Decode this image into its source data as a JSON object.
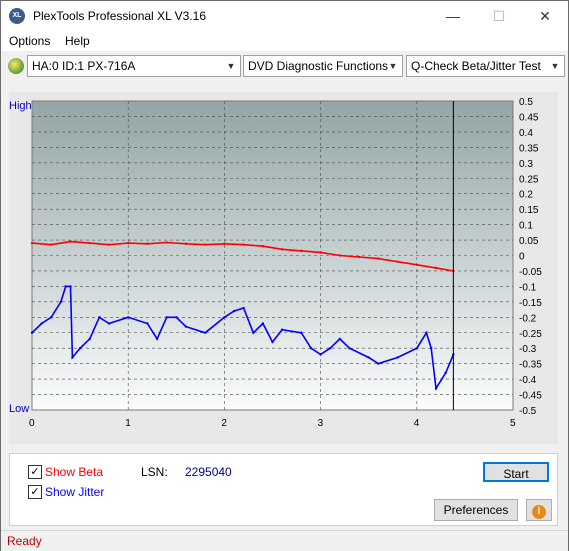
{
  "window": {
    "title": "PlexTools Professional XL V3.16",
    "app_icon_text": "XL",
    "minimize": "—",
    "maximize": "☐",
    "close": "✕"
  },
  "menu": {
    "options": "Options",
    "help": "Help"
  },
  "toolbar": {
    "drive": "HA:0 ID:1  PX-716A",
    "function": "DVD Diagnostic Functions",
    "test": "Q-Check Beta/Jitter Test"
  },
  "chart": {
    "label_high": "High",
    "label_low": "Low",
    "x_ticks": [
      "0",
      "1",
      "2",
      "3",
      "4",
      "5"
    ],
    "y_right_ticks": [
      "0.5",
      "0.45",
      "0.4",
      "0.35",
      "0.3",
      "0.25",
      "0.2",
      "0.15",
      "0.1",
      "0.05",
      "0",
      "-0.05",
      "-0.1",
      "-0.15",
      "-0.2",
      "-0.25",
      "-0.3",
      "-0.35",
      "-0.4",
      "-0.45",
      "-0.5"
    ],
    "colors": {
      "beta": "#ff0000",
      "jitter": "#0000ff",
      "marker": "#000000",
      "grid": "#4a4a4a",
      "text_blue": "#0000c8"
    }
  },
  "chart_data": {
    "type": "line",
    "xlabel": "",
    "ylabel": "",
    "xlim": [
      0,
      5
    ],
    "ylim": [
      -0.5,
      0.5
    ],
    "marker_x": 4.38,
    "series": [
      {
        "name": "Beta",
        "x": [
          0,
          0.2,
          0.4,
          0.6,
          0.8,
          1.0,
          1.2,
          1.4,
          1.6,
          1.8,
          2.0,
          2.2,
          2.4,
          2.6,
          2.8,
          3.0,
          3.2,
          3.4,
          3.6,
          3.8,
          4.0,
          4.2,
          4.38
        ],
        "values": [
          0.04,
          0.035,
          0.045,
          0.04,
          0.035,
          0.04,
          0.038,
          0.042,
          0.038,
          0.035,
          0.038,
          0.035,
          0.03,
          0.02,
          0.015,
          0.01,
          0.0,
          -0.005,
          -0.01,
          -0.02,
          -0.03,
          -0.04,
          -0.05
        ]
      },
      {
        "name": "Jitter",
        "x": [
          0,
          0.1,
          0.2,
          0.3,
          0.35,
          0.4,
          0.42,
          0.5,
          0.6,
          0.7,
          0.8,
          1.0,
          1.2,
          1.3,
          1.4,
          1.5,
          1.6,
          1.8,
          2.0,
          2.1,
          2.2,
          2.3,
          2.4,
          2.5,
          2.6,
          2.8,
          2.9,
          3.0,
          3.1,
          3.2,
          3.3,
          3.5,
          3.6,
          3.8,
          4.0,
          4.1,
          4.15,
          4.2,
          4.3,
          4.38
        ],
        "values": [
          -0.25,
          -0.22,
          -0.2,
          -0.15,
          -0.1,
          -0.1,
          -0.33,
          -0.3,
          -0.27,
          -0.2,
          -0.22,
          -0.2,
          -0.22,
          -0.27,
          -0.2,
          -0.2,
          -0.23,
          -0.25,
          -0.2,
          -0.18,
          -0.17,
          -0.25,
          -0.22,
          -0.28,
          -0.24,
          -0.25,
          -0.3,
          -0.32,
          -0.3,
          -0.27,
          -0.3,
          -0.33,
          -0.35,
          -0.33,
          -0.3,
          -0.25,
          -0.3,
          -0.43,
          -0.38,
          -0.32
        ]
      }
    ]
  },
  "options": {
    "show_beta": "Show Beta",
    "show_jitter": "Show Jitter",
    "beta_checked": "✓",
    "jitter_checked": "✓"
  },
  "lsn": {
    "label": "LSN:",
    "value": "2295040"
  },
  "buttons": {
    "start": "Start",
    "preferences": "Preferences",
    "info_icon": "i"
  },
  "status": {
    "text": "Ready"
  }
}
